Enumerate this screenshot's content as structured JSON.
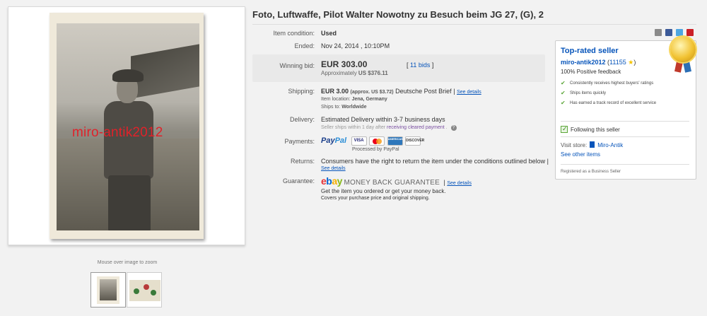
{
  "listing": {
    "title": "Foto, Luftwaffe, Pilot Walter Nowotny zu Besuch beim JG 27, (G), 2",
    "condition_label": "Item condition:",
    "condition_value": "Used",
    "ended_label": "Ended:",
    "ended_value": "Nov 24, 2014 , 10:10PM",
    "winning_bid_label": "Winning bid:",
    "winning_bid_value": "EUR 303.00",
    "approx_prefix": "Approximately",
    "approx_value": "US $376.11",
    "bids_open": "[",
    "bids_link": "11 bids",
    "bids_close": "]"
  },
  "shipping": {
    "label": "Shipping:",
    "cost": "EUR 3.00",
    "approx": "(approx. US $3.72)",
    "service": "Deutsche Post Brief",
    "separator": "|",
    "see_details": "See details",
    "location_label": "Item location:",
    "location_value": "Jena, Germany",
    "ships_to_label": "Ships to:",
    "ships_to_value": "Worldwide"
  },
  "delivery": {
    "label": "Delivery:",
    "estimate": "Estimated Delivery within 3-7 business days",
    "note_prefix": "Seller ships within 1 day after",
    "note_link": "receiving cleared payment",
    "note_suffix": ".",
    "help_icon": "?"
  },
  "payments": {
    "label": "Payments:",
    "paypal_a": "Pay",
    "paypal_b": "Pal",
    "processed": "Processed by PayPal",
    "cards": [
      "VISA",
      "",
      "AMERICAN EXPRESS",
      "DISCOVER"
    ]
  },
  "returns": {
    "label": "Returns:",
    "text": "Consumers have the right to return the item under the conditions outlined below |",
    "see_details": "See details"
  },
  "guarantee": {
    "label": "Guarantee:",
    "ebay": [
      "e",
      "b",
      "a",
      "y"
    ],
    "mbg": "MONEY BACK GUARANTEE",
    "separator": "|",
    "see_details": "See details",
    "line1": "Get the item you ordered or get your money back.",
    "line2": "Covers your purchase price and original shipping."
  },
  "seller": {
    "heading": "Top-rated seller",
    "username": "miro-antik2012",
    "feedback_open": "(",
    "feedback_score": "11155",
    "feedback_close": ")",
    "positive": "100% Positive feedback",
    "bullets": [
      "Consistently receives highest buyers' ratings",
      "Ships items quickly",
      "Has earned a track record of excellent service"
    ],
    "following": "Following this seller",
    "visit_store_label": "Visit store:",
    "store_name": "Miro-Antik",
    "see_other": "See other items",
    "registered": "Registered as a Business Seller"
  },
  "gallery": {
    "watermark": "miro-antik2012",
    "zoom_hint": "Mouse over image to zoom"
  },
  "colors": {
    "link": "#0654ba",
    "accent_green": "#5ba637",
    "watermark_red": "#e0222a"
  }
}
